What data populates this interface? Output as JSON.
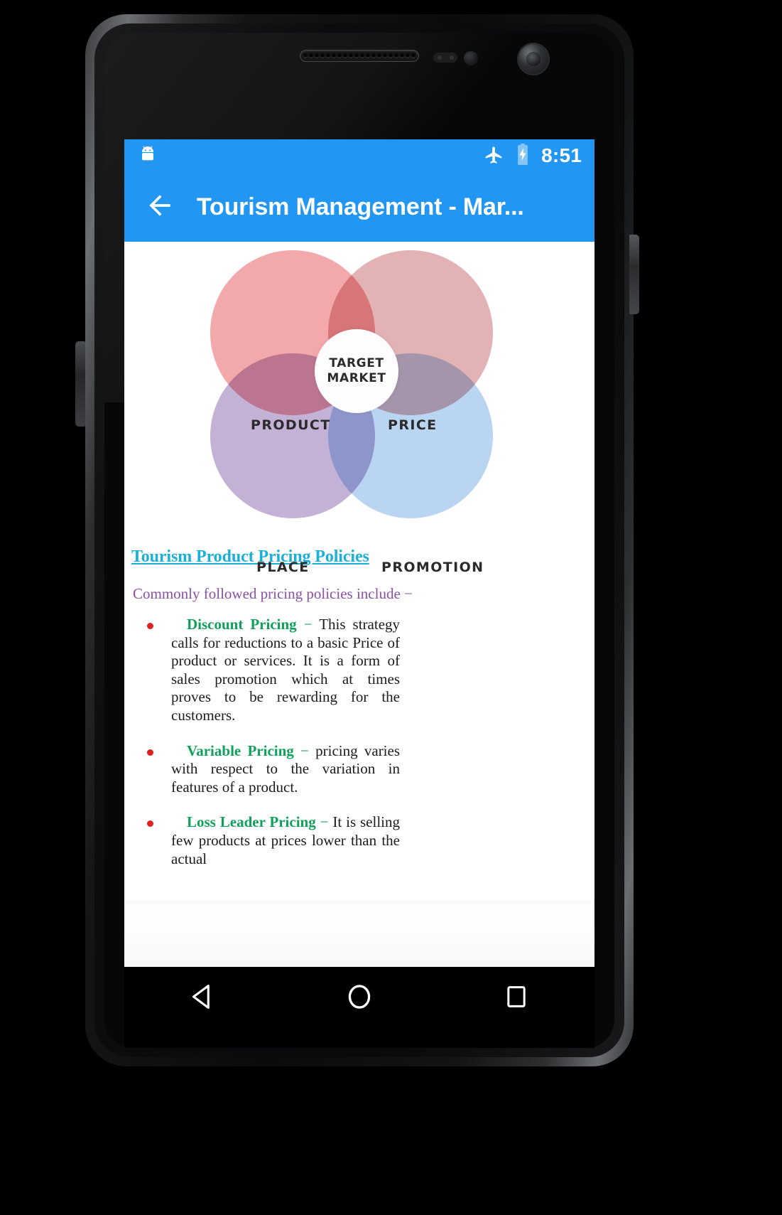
{
  "status_bar": {
    "app_icon": "android-robot-icon",
    "airplane_mode_icon": "airplane-mode-icon",
    "battery_icon": "battery-charging-icon",
    "clock": "8:51"
  },
  "app_bar": {
    "back_icon": "back-arrow-icon",
    "title": "Tourism Management - Mar..."
  },
  "figure": {
    "name": "marketing-mix-venn-diagram",
    "center_line1": "TARGET",
    "center_line2": "MARKET",
    "circles": [
      {
        "label": "PRODUCT",
        "color": "#f3a8ac"
      },
      {
        "label": "PRICE",
        "color": "#e2b2b4"
      },
      {
        "label": "PLACE",
        "color": "#c4b2d6"
      },
      {
        "label": "PROMOTION",
        "color": "#b9d5f2"
      }
    ]
  },
  "article": {
    "heading": "Tourism Product Pricing Policies",
    "heading_color": "#1ab0d8",
    "intro": "Commonly followed pricing policies include −",
    "intro_color": "#8b4fa8",
    "term_color": "#0fa15a",
    "bullet_color": "#e02020",
    "bullets": [
      {
        "term": "Discount Pricing",
        "dash": "−",
        "text": "This strategy calls for reductions to a basic Price of product or services. It is a form of sales promotion which at times proves to be rewarding for the customers."
      },
      {
        "term": "Variable Pricing",
        "dash": "−",
        "text": "pricing varies with respect to the variation in features of a product."
      },
      {
        "term": "Loss Leader Pricing",
        "dash": "−",
        "text": "It is selling few products at prices lower than the actual"
      }
    ]
  },
  "nav_bar": {
    "back": "nav-back-icon",
    "home": "nav-home-icon",
    "recents": "nav-recents-icon"
  }
}
